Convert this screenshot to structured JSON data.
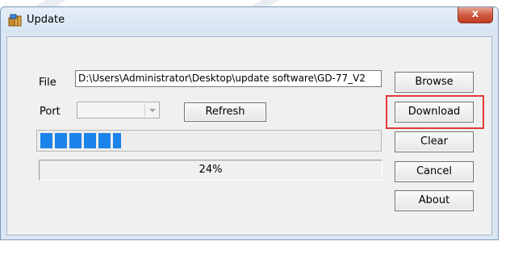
{
  "window": {
    "title": "Update",
    "close_label": "x"
  },
  "form": {
    "file_label": "File",
    "file_value": "D:\\Users\\Administrator\\Desktop\\update software\\GD-77_V2",
    "port_label": "Port",
    "port_value": "",
    "refresh_label": "Refresh"
  },
  "progress": {
    "percent_text": "24%",
    "fraction": 0.24
  },
  "buttons": {
    "browse": "Browse",
    "download": "Download",
    "clear": "Clear",
    "cancel": "Cancel",
    "about": "About"
  },
  "colors": {
    "progress_block": "#1a84ea",
    "highlight": "#e23a3a",
    "close_button": "#c7432a"
  },
  "icons": {
    "app": "box-icon",
    "combo": "chevron-down-icon"
  }
}
